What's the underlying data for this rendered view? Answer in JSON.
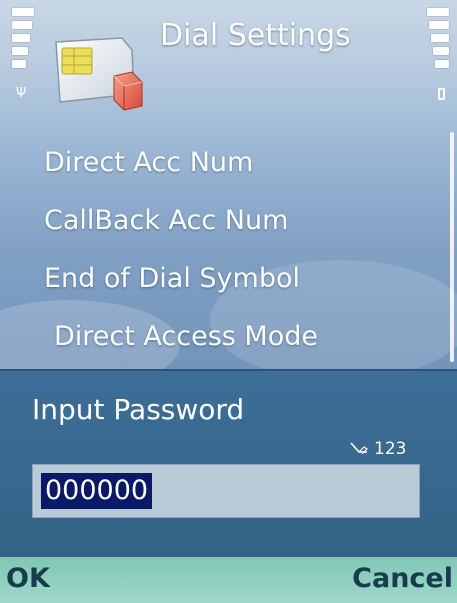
{
  "header": {
    "title": "Dial Settings",
    "app_icon": "sim-card-icon",
    "signal_icon": "signal-strength-icon",
    "battery_icon": "battery-level-icon"
  },
  "menu": {
    "items": [
      {
        "label": "Direct Acc Num"
      },
      {
        "label": "CallBack Acc Num"
      },
      {
        "label": "End of Dial Symbol"
      },
      {
        "label": "Direct Access Mode"
      }
    ]
  },
  "dialog": {
    "title": "Input Password",
    "input_mode": "123",
    "input_mode_icon": "pen-icon",
    "input_value": "000000"
  },
  "softkeys": {
    "left": "OK",
    "right": "Cancel"
  },
  "colors": {
    "dialog_bg": "#3d6e97",
    "selection": "#0b1a66",
    "softkey_bar": "#8fd0bf"
  }
}
